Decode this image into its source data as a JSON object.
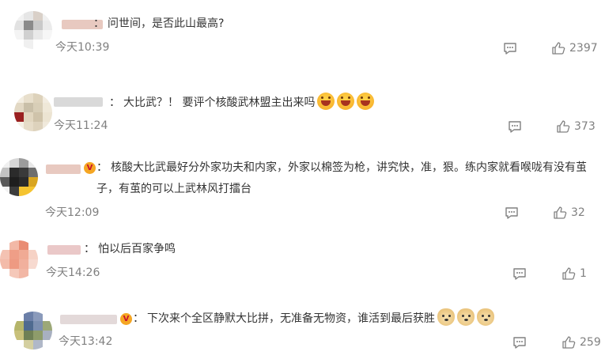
{
  "comments": [
    {
      "avatar": [
        "#f2f2f2",
        "#e6e6e6",
        "#d9d0c8",
        "#f0f0f0",
        "#e2e2e2",
        "#8a8a8a",
        "#c9c9c9",
        "#ebebeb",
        "#f4f4f4",
        "#d0d0d0",
        "#e9e9e9",
        "#f6f6f6",
        "#ffffff",
        "#f0f0f0",
        "#ffffff",
        "#ffffff"
      ],
      "name_color": "#e8c9c0",
      "colon": "：",
      "text": "问世间，是否此山最高?",
      "emojis": [],
      "time": "今天10:39",
      "likes": "2397"
    },
    {
      "avatar": [
        "#f3ede0",
        "#e8dfcc",
        "#ddd2bb",
        "#f2ece0",
        "#e2d8c4",
        "#c9bfa8",
        "#d8ceb7",
        "#efe8d8",
        "#9a2020",
        "#e1d6bf",
        "#cfc3aa",
        "#ece4d2",
        "#f5f0e5",
        "#e6dcc8",
        "#ddd2bc",
        "#f0e9db"
      ],
      "name_color": "#d9d9d9",
      "colon": "：",
      "text": "大比武？！ 要评个核酸武林盟主出来吗",
      "emojis": [
        "laugh-emoji",
        "laugh-emoji",
        "laugh-emoji"
      ],
      "time": "今天11:24",
      "likes": "373"
    },
    {
      "avatar": [
        "#f0f0f0",
        "#d6d6d6",
        "#9c9c9c",
        "#e8e8e8",
        "#c2c2c2",
        "#2b2b2b",
        "#3a3a3a",
        "#6e6e6e",
        "#5a5a5a",
        "#1e1e1e",
        "#2a2a2a",
        "#d9a520",
        "#f2f2f2",
        "#3c3c3c",
        "#f5c430",
        "#f5c430"
      ],
      "name_color": "#e8c9c0",
      "vip": "V",
      "colon": "：",
      "text": "核酸大比武最好分外家功夫和内家，外家以棉签为枪，讲究快，准，狠。练内家就看喉咙有没有茧子，有茧的可以上武林风打擂台",
      "emojis": [],
      "time": "今天12:09",
      "likes": "32"
    },
    {
      "avatar": [
        "#ffffff",
        "#f2b8a6",
        "#e98c73",
        "#ffffff",
        "#f4c2b2",
        "#ef9e87",
        "#f0aa94",
        "#f6d2c5",
        "#f3bba9",
        "#ee9a82",
        "#f1b09d",
        "#f7dad0",
        "#ffffff",
        "#f5c8b9",
        "#f2b7a5",
        "#ffffff"
      ],
      "name_color": "#eac8c8",
      "colon": "：",
      "text": "怕以后百家争鸣",
      "emojis": [],
      "time": "今天14:26",
      "likes": "1"
    },
    {
      "avatar": [
        "#ffffff",
        "#6b7fa8",
        "#8a9abb",
        "#ffffff",
        "#b5b56a",
        "#4f6a8f",
        "#7c8fb0",
        "#9ca878",
        "#c8c07a",
        "#6f8055",
        "#8e9c6a",
        "#a8b0c0",
        "#ffffff",
        "#d4cfa0",
        "#b0b8c8",
        "#ffffff"
      ],
      "name_color": "#e3d9d9",
      "vip": "V",
      "colon": "：",
      "text": "下次来个全区静默大比拼，无准备无物资，谁活到最后获胜",
      "emojis": [
        "doge-emoji",
        "doge-emoji",
        "doge-emoji"
      ],
      "time": "今天13:42",
      "likes": "259"
    }
  ]
}
